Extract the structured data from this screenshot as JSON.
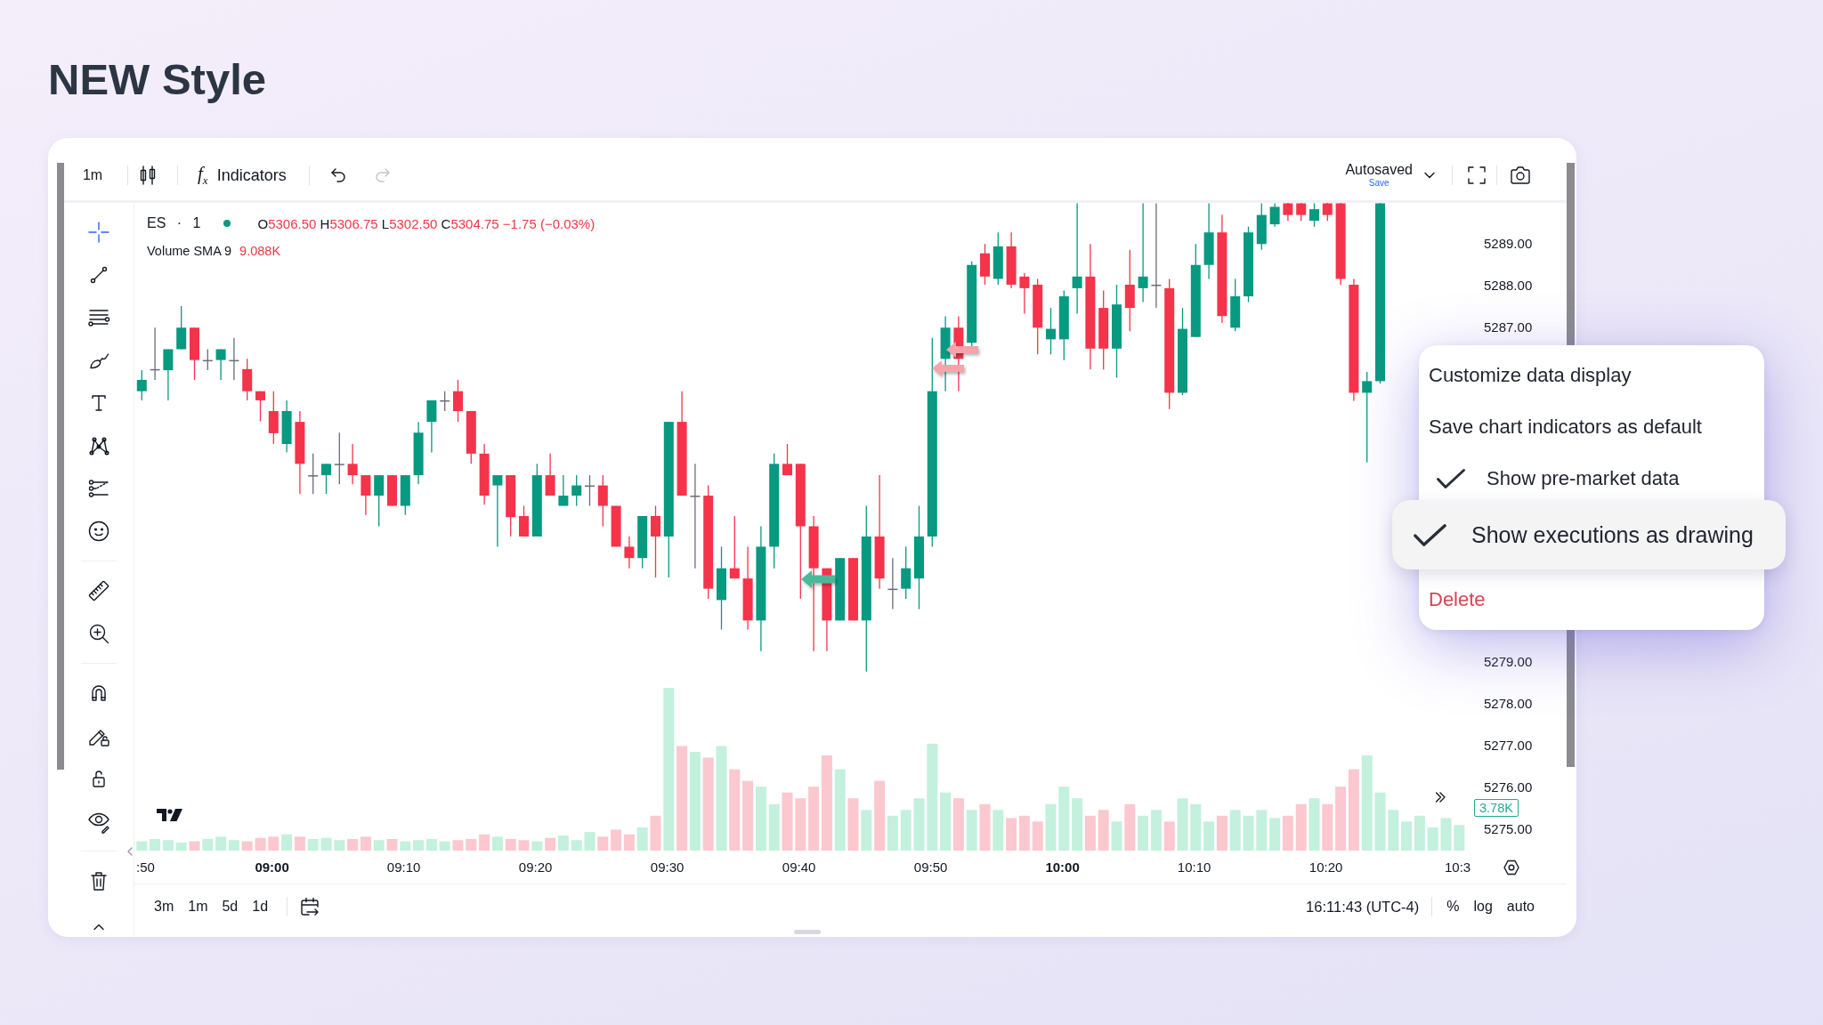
{
  "page_title": "NEW Style",
  "top_toolbar": {
    "interval": "1m",
    "indicators": {
      "symbol": "f$_{x}$",
      "label": "Indicators"
    },
    "history": [
      {
        "kind": "undo",
        "disabled": false
      },
      {
        "kind": "redo",
        "disabled": true
      }
    ],
    "autosave": {
      "status": "Autosaved",
      "action": "Save"
    }
  },
  "drawing_tools": [
    {
      "tools": [
        {
          "kind": "crosshair",
          "selected": true
        },
        {
          "kind": "trend_line",
          "selected": false
        },
        {
          "kind": "fib_levels",
          "selected": false
        },
        {
          "kind": "brush",
          "selected": false
        },
        {
          "kind": "text",
          "selected": false
        },
        {
          "kind": "pattern",
          "selected": false
        },
        {
          "kind": "projection",
          "selected": false
        },
        {
          "kind": "emoji",
          "selected": false
        }
      ]
    },
    {
      "tools": [
        {
          "kind": "ruler",
          "selected": false
        },
        {
          "kind": "zoom",
          "selected": false
        }
      ]
    },
    {
      "tools": [
        {
          "kind": "magnet",
          "selected": false
        },
        {
          "kind": "lock_drawings",
          "selected": false
        },
        {
          "kind": "lock",
          "selected": false
        },
        {
          "kind": "hide",
          "selected": false
        }
      ]
    },
    {
      "tools": [
        {
          "kind": "trash",
          "selected": false
        }
      ]
    }
  ],
  "legend": {
    "title": "ES · 1",
    "market_open": true,
    "falling": true,
    "ohlc": [
      {
        "key": "O",
        "value": "5306.50"
      },
      {
        "key": "H",
        "value": "5306.75"
      },
      {
        "key": "L",
        "value": "5302.50"
      },
      {
        "key": "C",
        "value": "5304.75"
      }
    ],
    "change": "−1.75 (−0.03%)",
    "study": "Volume SMA 9",
    "study_value": "9.088K"
  },
  "price_axis": {
    "upper": [
      "5289.00",
      "5288.00",
      "5287.00"
    ],
    "lower": [
      "5279.00",
      "5278.00",
      "5277.00",
      "5276.00",
      "5275.00"
    ],
    "last_volume": "3.78K"
  },
  "time_axis": [
    {
      "label": ":50",
      "major": false
    },
    {
      "label": "09:00",
      "major": true
    },
    {
      "label": "09:10",
      "major": false
    },
    {
      "label": "09:20",
      "major": false
    },
    {
      "label": "09:30",
      "major": false
    },
    {
      "label": "09:40",
      "major": false
    },
    {
      "label": "09:50",
      "major": false
    },
    {
      "label": "10:00",
      "major": true
    },
    {
      "label": "10:10",
      "major": false
    },
    {
      "label": "10:20",
      "major": false
    },
    {
      "label": "10:3",
      "major": false
    }
  ],
  "bottom_bar": {
    "ranges": [
      "3m",
      "1m",
      "5d",
      "1d"
    ],
    "clock": "16:11:43 (UTC-4)",
    "scale_options": [
      "%",
      "log",
      "auto"
    ]
  },
  "context_menu": {
    "items": [
      {
        "kind": "action",
        "label": "Customize data display",
        "checked": false,
        "highlighted": false
      },
      {
        "kind": "action",
        "label": "Save chart indicators as default",
        "checked": false,
        "highlighted": false
      },
      {
        "kind": "toggle",
        "label": "Show pre-market data",
        "checked": true,
        "highlighted": false
      },
      {
        "kind": "toggle",
        "label": "Show executions as drawing",
        "checked": true,
        "highlighted": true
      },
      {
        "kind": "danger",
        "label": "Delete",
        "checked": false,
        "highlighted": false
      }
    ]
  }
}
